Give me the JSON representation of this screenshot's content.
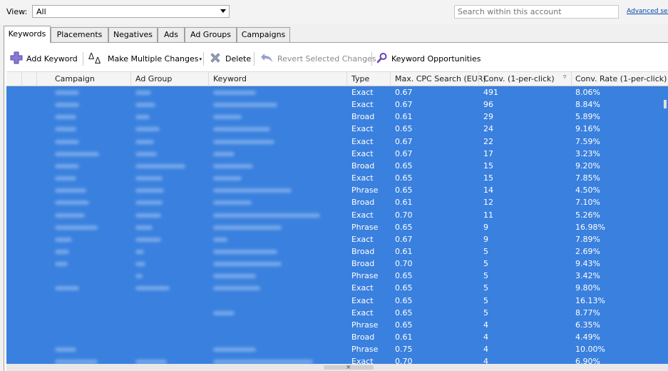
{
  "view": {
    "label": "View:",
    "selected": "All"
  },
  "search": {
    "placeholder": "Search within this account",
    "advanced_link": "Advanced sea"
  },
  "tabs": [
    {
      "label": "Keywords",
      "active": true
    },
    {
      "label": "Placements",
      "active": false
    },
    {
      "label": "Negatives",
      "active": false
    },
    {
      "label": "Ads",
      "active": false
    },
    {
      "label": "Ad Groups",
      "active": false
    },
    {
      "label": "Campaigns",
      "active": false
    }
  ],
  "toolbar": {
    "add_keyword": "Add Keyword",
    "make_multiple_changes": "Make Multiple Changes",
    "delete": "Delete",
    "revert": "Revert Selected Changes",
    "keyword_opportunities": "Keyword Opportunities"
  },
  "columns": {
    "campaign": "Campaign",
    "ad_group": "Ad Group",
    "keyword": "Keyword",
    "type": "Type",
    "max_cpc": "Max. CPC Search (EUR)",
    "conv": "Conv. (1-per-click)",
    "conv_rate": "Conv. Rate (1-per-click)"
  },
  "rows": [
    {
      "type": "Exact",
      "max_cpc": "0.67",
      "conv": "491",
      "conv_rate": "8.06%"
    },
    {
      "type": "Exact",
      "max_cpc": "0.67",
      "conv": "96",
      "conv_rate": "8.84%"
    },
    {
      "type": "Broad",
      "max_cpc": "0.61",
      "conv": "29",
      "conv_rate": "5.89%"
    },
    {
      "type": "Exact",
      "max_cpc": "0.65",
      "conv": "24",
      "conv_rate": "9.16%"
    },
    {
      "type": "Exact",
      "max_cpc": "0.67",
      "conv": "22",
      "conv_rate": "7.59%"
    },
    {
      "type": "Exact",
      "max_cpc": "0.67",
      "conv": "17",
      "conv_rate": "3.23%"
    },
    {
      "type": "Broad",
      "max_cpc": "0.65",
      "conv": "15",
      "conv_rate": "9.20%"
    },
    {
      "type": "Exact",
      "max_cpc": "0.65",
      "conv": "15",
      "conv_rate": "7.85%"
    },
    {
      "type": "Phrase",
      "max_cpc": "0.65",
      "conv": "14",
      "conv_rate": "4.50%"
    },
    {
      "type": "Broad",
      "max_cpc": "0.61",
      "conv": "12",
      "conv_rate": "7.10%"
    },
    {
      "type": "Exact",
      "max_cpc": "0.70",
      "conv": "11",
      "conv_rate": "5.26%"
    },
    {
      "type": "Phrase",
      "max_cpc": "0.65",
      "conv": "9",
      "conv_rate": "16.98%"
    },
    {
      "type": "Exact",
      "max_cpc": "0.67",
      "conv": "9",
      "conv_rate": "7.89%"
    },
    {
      "type": "Broad",
      "max_cpc": "0.61",
      "conv": "5",
      "conv_rate": "2.69%"
    },
    {
      "type": "Broad",
      "max_cpc": "0.70",
      "conv": "5",
      "conv_rate": "9.43%"
    },
    {
      "type": "Phrase",
      "max_cpc": "0.65",
      "conv": "5",
      "conv_rate": "3.42%"
    },
    {
      "type": "Exact",
      "max_cpc": "0.65",
      "conv": "5",
      "conv_rate": "9.80%"
    },
    {
      "type": "Exact",
      "max_cpc": "0.65",
      "conv": "5",
      "conv_rate": "16.13%"
    },
    {
      "type": "Exact",
      "max_cpc": "0.65",
      "conv": "5",
      "conv_rate": "8.77%"
    },
    {
      "type": "Phrase",
      "max_cpc": "0.65",
      "conv": "4",
      "conv_rate": "6.35%"
    },
    {
      "type": "Broad",
      "max_cpc": "0.61",
      "conv": "4",
      "conv_rate": "4.49%"
    },
    {
      "type": "Phrase",
      "max_cpc": "0.75",
      "conv": "4",
      "conv_rate": "10.00%"
    },
    {
      "type": "Exact",
      "max_cpc": "0.70",
      "conv": "4",
      "conv_rate": "6.90%"
    }
  ],
  "colors": {
    "selection": "#3a80de",
    "link": "#0645ad",
    "add_icon": "#7a64c8",
    "search_icon": "#6a3fb0"
  }
}
